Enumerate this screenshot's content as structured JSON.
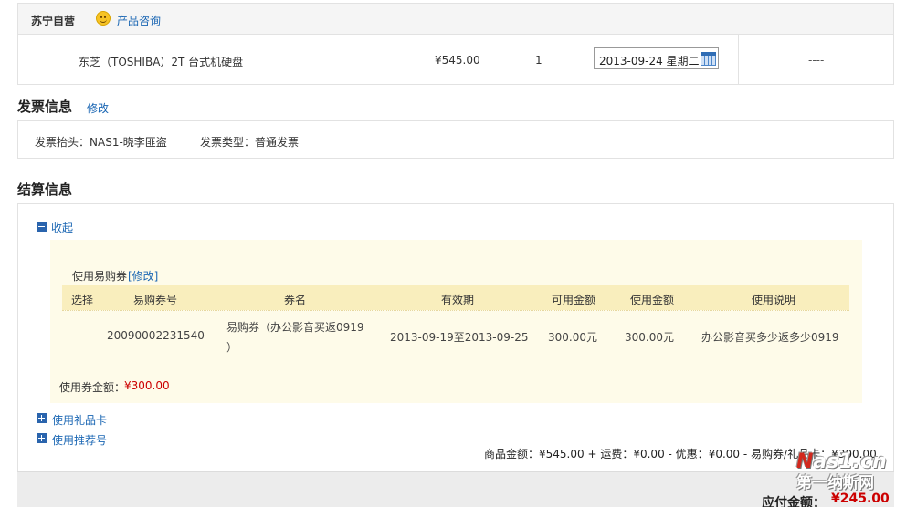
{
  "order": {
    "store_name": "苏宁自营",
    "consult_link": "产品咨询",
    "product_name": "东芝（TOSHIBA）2T 台式机硬盘",
    "price": "¥545.00",
    "quantity": "1",
    "delivery_date": "2013-09-24 星期二",
    "extra": "----"
  },
  "invoice": {
    "section_title": "发票信息",
    "edit_link": "修改",
    "title_label": "发票抬头：",
    "title_value": "NAS1-晓李匪盗",
    "type_label": "发票类型：",
    "type_value": "普通发票"
  },
  "settlement": {
    "section_title": "结算信息",
    "collapse_label": "收起",
    "coupon": {
      "use_label": "使用易购券",
      "edit_link": "[修改]",
      "columns": [
        "选择",
        "易购券号",
        "券名",
        "有效期",
        "可用金额",
        "使用金额",
        "使用说明"
      ],
      "row": {
        "number": "20090002231540",
        "name_line1": "易购券（办公影音买返0919",
        "name_line2": "）",
        "validity": "2013-09-19至2013-09-25",
        "available": "300.00元",
        "used": "300.00元",
        "description": "办公影音买多少返多少0919"
      },
      "total_label": "使用券金额：",
      "total_value": "¥300.00"
    },
    "gift_card_label": "使用礼品卡",
    "referral_label": "使用推荐号",
    "summary": {
      "goods_label": "商品金额：",
      "goods_value": "¥545.00",
      "shipping_label": "+ 运费：",
      "shipping_value": "¥0.00",
      "discount_label": "- 优惠：",
      "discount_value": "¥0.00",
      "coupon_label": "- 易购券/礼品卡：",
      "coupon_value": "¥300.00"
    },
    "payable_label": "应付金额：",
    "payable_value": "¥245.00"
  },
  "watermark": {
    "line1_n": "N",
    "line1_rest": "as1.cn",
    "line2": "第一纳斯网"
  },
  "colors": {
    "link": "#1a66b3",
    "price_red": "#cc0000",
    "coupon_panel": "#fefbe9",
    "coupon_header": "#f9eebd",
    "icon_blue": "#2a64ad"
  }
}
